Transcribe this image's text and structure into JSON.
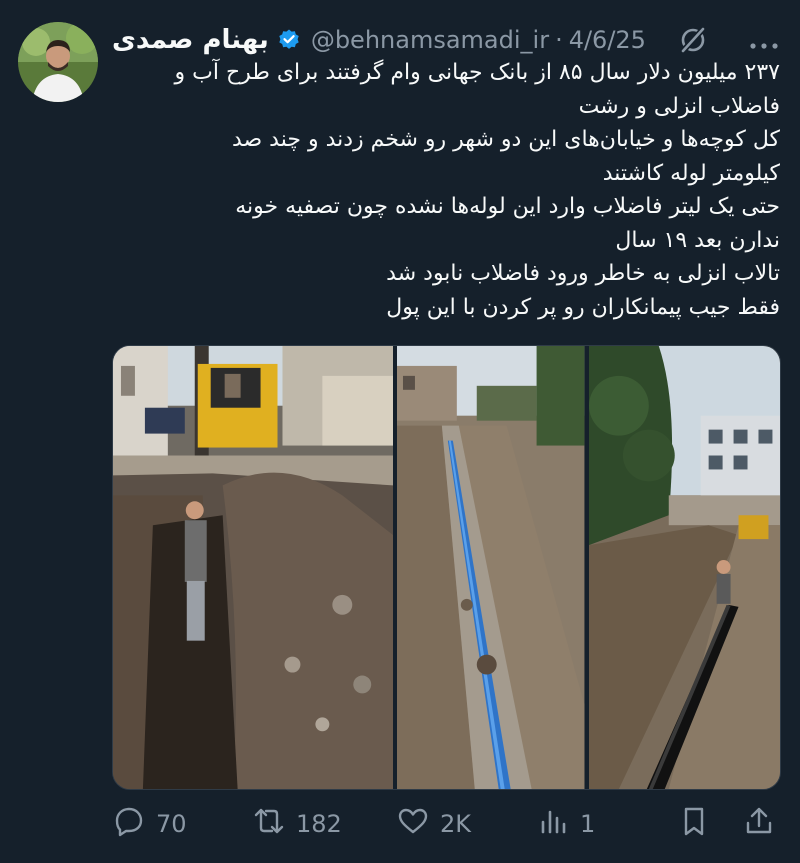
{
  "author": {
    "display_name": "بهنام صمدی",
    "handle": "@behnamsamadi_ir",
    "separator": "·",
    "date": "4/6/25",
    "verified": true
  },
  "tweet": {
    "lines": [
      "۲۳۷ میلیون دلار سال ۸۵ از بانک جهانی وام گرفتند برای طرح آب و",
      "فاضلاب انزلی و رشت",
      "کل کوچه‌ها و خیابان‌های این دو شهر رو شخم زدند و چند صد",
      "کیلومتر لوله کاشتند",
      "حتی یک لیتر فاضلاب وارد این لوله‌ها نشده چون تصفیه خونه",
      "ندارن بعد ۱۹ سال",
      "تالاب انزلی به خاطر ورود فاضلاب نابود شد",
      "فقط جیب پیمانکاران رو پر کردن با این پول"
    ]
  },
  "media": {
    "photos": [
      "excavator-trench-photo",
      "blue-pipe-trench-photo",
      "black-pipe-trench-photo"
    ]
  },
  "actions": {
    "reply": {
      "icon": "reply-icon",
      "count": "70"
    },
    "retweet": {
      "icon": "retweet-icon",
      "count": "182"
    },
    "like": {
      "icon": "heart-icon",
      "count": "2K"
    },
    "views": {
      "icon": "views-icon",
      "count": "1"
    },
    "bookmark": {
      "icon": "bookmark-icon"
    },
    "share": {
      "icon": "share-icon"
    }
  },
  "colors": {
    "background": "#15202b",
    "text": "#f7f9f9",
    "muted": "#8b98a5",
    "verified": "#1d9bf0"
  }
}
